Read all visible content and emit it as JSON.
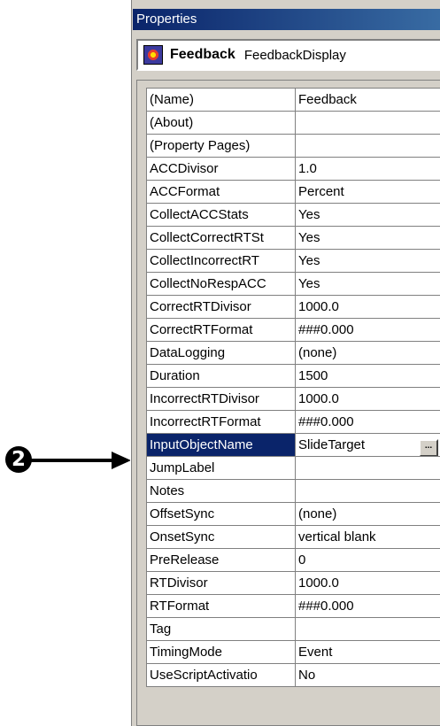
{
  "window": {
    "title": "Properties"
  },
  "object_selector": {
    "name": "Feedback",
    "type": "FeedbackDisplay",
    "icon": "feedback-object-icon"
  },
  "annotation": {
    "badge": "2"
  },
  "properties": [
    {
      "name": "(Name)",
      "value": "Feedback"
    },
    {
      "name": "(About)",
      "value": ""
    },
    {
      "name": "(Property Pages)",
      "value": ""
    },
    {
      "name": "ACCDivisor",
      "value": "1.0"
    },
    {
      "name": "ACCFormat",
      "value": "Percent"
    },
    {
      "name": "CollectACCStats",
      "value": "Yes"
    },
    {
      "name": "CollectCorrectRTSt",
      "value": "Yes"
    },
    {
      "name": "CollectIncorrectRT",
      "value": "Yes"
    },
    {
      "name": "CollectNoRespACC",
      "value": "Yes"
    },
    {
      "name": "CorrectRTDivisor",
      "value": "1000.0"
    },
    {
      "name": "CorrectRTFormat",
      "value": "###0.000"
    },
    {
      "name": "DataLogging",
      "value": "(none)"
    },
    {
      "name": "Duration",
      "value": "1500"
    },
    {
      "name": "IncorrectRTDivisor",
      "value": "1000.0"
    },
    {
      "name": "IncorrectRTFormat",
      "value": "###0.000"
    },
    {
      "name": "InputObjectName",
      "value": "SlideTarget",
      "selected": true,
      "button": "..."
    },
    {
      "name": "JumpLabel",
      "value": ""
    },
    {
      "name": "Notes",
      "value": ""
    },
    {
      "name": "OffsetSync",
      "value": "(none)"
    },
    {
      "name": "OnsetSync",
      "value": "vertical blank"
    },
    {
      "name": "PreRelease",
      "value": "0"
    },
    {
      "name": "RTDivisor",
      "value": "1000.0"
    },
    {
      "name": "RTFormat",
      "value": "###0.000"
    },
    {
      "name": "Tag",
      "value": ""
    },
    {
      "name": "TimingMode",
      "value": "Event"
    },
    {
      "name": "UseScriptActivatio",
      "value": "No"
    }
  ],
  "colors": {
    "selection": "#0a246a",
    "titlebar": "#0a246a",
    "face": "#d4d0c8"
  }
}
